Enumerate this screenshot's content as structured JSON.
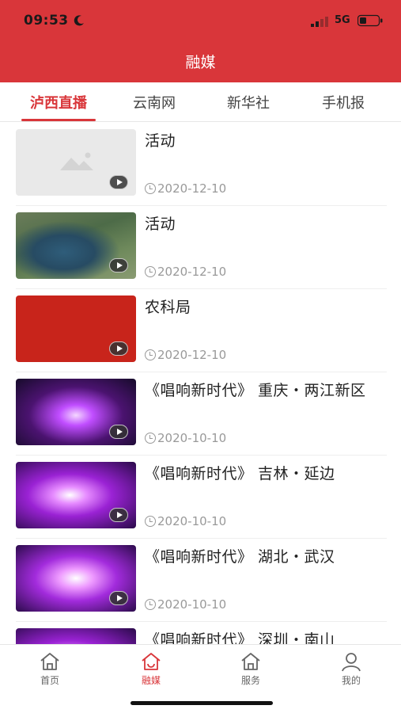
{
  "status_bar": {
    "time": "09:53",
    "network": "5G"
  },
  "header": {
    "title": "融媒"
  },
  "tabs": [
    {
      "label": "泸西直播",
      "active": true
    },
    {
      "label": "云南网",
      "active": false
    },
    {
      "label": "新华社",
      "active": false
    },
    {
      "label": "手机报",
      "active": false
    }
  ],
  "items": [
    {
      "title": "活动",
      "date": "2020-12-10",
      "thumb": "placeholder-image"
    },
    {
      "title": "活动",
      "date": "2020-12-10",
      "thumb": "aerial-lake-photo"
    },
    {
      "title": "农科局",
      "date": "2020-12-10",
      "thumb": "red-background"
    },
    {
      "title": "《唱响新时代》 重庆・两江新区",
      "date": "2020-10-10",
      "thumb": "stage-performance"
    },
    {
      "title": "《唱响新时代》 吉林・延边",
      "date": "2020-10-10",
      "thumb": "stage-performance"
    },
    {
      "title": "《唱响新时代》 湖北・武汉",
      "date": "2020-10-10",
      "thumb": "stage-performance"
    },
    {
      "title": "《唱响新时代》 深圳・南山",
      "date": "",
      "thumb": "stage-performance"
    }
  ],
  "bottom_nav": [
    {
      "label": "首页",
      "icon": "home-icon",
      "active": false
    },
    {
      "label": "融媒",
      "icon": "media-icon",
      "active": true
    },
    {
      "label": "服务",
      "icon": "service-icon",
      "active": false
    },
    {
      "label": "我的",
      "icon": "profile-icon",
      "active": false
    }
  ],
  "colors": {
    "brand_red": "#d9363a",
    "muted_text": "#999999"
  }
}
